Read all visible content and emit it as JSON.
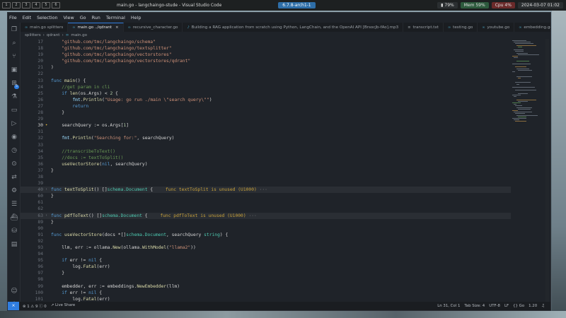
{
  "system_bar": {
    "workspaces": [
      "1",
      "2",
      "3",
      "4",
      "5",
      "6"
    ],
    "window_title": "main.go - langchaingo-stude - Visual Studio Code",
    "kernel": "6.7.8-arch1-1",
    "battery": "79%",
    "memory": "Mem 59%",
    "cpu": "Cpu  4%",
    "datetime": "2024-03-07 01:02"
  },
  "menu": [
    "File",
    "Edit",
    "Selection",
    "View",
    "Go",
    "Run",
    "Terminal",
    "Help"
  ],
  "tabs": [
    {
      "label": "main.go  splitters",
      "active": false,
      "kind": "go"
    },
    {
      "label": "main.go  ../qdrant",
      "active": true,
      "kind": "go"
    },
    {
      "label": "recursive_character.go",
      "active": false,
      "kind": "go"
    },
    {
      "label": "Building a RAG application from scratch using Python, LangChain, and the OpenAI API [BrsocJb-fAo].mp3",
      "active": false,
      "kind": "media"
    },
    {
      "label": "transcript.txt",
      "active": false,
      "kind": "txt"
    },
    {
      "label": "testing.go",
      "active": false,
      "kind": "go"
    },
    {
      "label": "youtube.go",
      "active": false,
      "kind": "go"
    },
    {
      "label": "embedding.go",
      "active": false,
      "kind": "go"
    }
  ],
  "breadcrumb": [
    "splitters",
    "qdrant",
    "main.go"
  ],
  "editor_lines": [
    {
      "n": "17",
      "parts": [
        [
          "str",
          "\"github.com/tmc/langchaingo/schema\""
        ]
      ],
      "indent": 1
    },
    {
      "n": "18",
      "parts": [
        [
          "str",
          "\"github.com/tmc/langchaingo/textsplitter\""
        ]
      ],
      "indent": 1
    },
    {
      "n": "19",
      "parts": [
        [
          "str",
          "\"github.com/tmc/langchaingo/vectorstores\""
        ]
      ],
      "indent": 1
    },
    {
      "n": "20",
      "parts": [
        [
          "str",
          "\"github.com/tmc/langchaingo/vectorstores/qdrant\""
        ]
      ],
      "indent": 1
    },
    {
      "n": "21",
      "parts": [
        [
          "pl",
          ")"
        ]
      ],
      "indent": 0
    },
    {
      "n": "22",
      "parts": [],
      "indent": 0
    },
    {
      "n": "23",
      "parts": [
        [
          "kw",
          "func "
        ],
        [
          "fn",
          "main"
        ],
        [
          "pl",
          "() {"
        ]
      ],
      "indent": 0
    },
    {
      "n": "24",
      "parts": [
        [
          "cm",
          "//get param in cli"
        ]
      ],
      "indent": 1
    },
    {
      "n": "25",
      "parts": [
        [
          "kw",
          "if "
        ],
        [
          "fn",
          "len"
        ],
        [
          "pl",
          "(os.Args) < "
        ],
        [
          "num",
          "2"
        ],
        [
          "pl",
          " {"
        ]
      ],
      "indent": 1
    },
    {
      "n": "26",
      "parts": [
        [
          "pk",
          "fmt"
        ],
        [
          "pl",
          "."
        ],
        [
          "fn",
          "Println"
        ],
        [
          "pl",
          "("
        ],
        [
          "str",
          "\"Usage: go run ./main \\\"search query\\\"\""
        ],
        [
          "pl",
          ")"
        ]
      ],
      "indent": 2
    },
    {
      "n": "27",
      "parts": [
        [
          "kw",
          "return"
        ]
      ],
      "indent": 2
    },
    {
      "n": "28",
      "parts": [
        [
          "pl",
          "}"
        ]
      ],
      "indent": 1
    },
    {
      "n": "29",
      "parts": [],
      "indent": 0
    },
    {
      "n": "30",
      "parts": [
        [
          "pl",
          "searchQuery := os.Args["
        ],
        [
          "num",
          "1"
        ],
        [
          "pl",
          "]"
        ]
      ],
      "indent": 1,
      "bulb": true,
      "current": true
    },
    {
      "n": "31",
      "parts": [],
      "indent": 0
    },
    {
      "n": "32",
      "parts": [
        [
          "pk",
          "fmt"
        ],
        [
          "pl",
          "."
        ],
        [
          "fn",
          "Println"
        ],
        [
          "pl",
          "("
        ],
        [
          "str",
          "\"Searching for:\""
        ],
        [
          "pl",
          ", searchQuery)"
        ]
      ],
      "indent": 1
    },
    {
      "n": "33",
      "parts": [],
      "indent": 0
    },
    {
      "n": "34",
      "parts": [
        [
          "cm",
          "//transcribeToText()"
        ]
      ],
      "indent": 1
    },
    {
      "n": "35",
      "parts": [
        [
          "cm",
          "//docs := textToSplit()"
        ]
      ],
      "indent": 1
    },
    {
      "n": "36",
      "parts": [
        [
          "fn",
          "useVectorStore"
        ],
        [
          "pl",
          "("
        ],
        [
          "kw",
          "nil"
        ],
        [
          "pl",
          ", searchQuery)"
        ]
      ],
      "indent": 1
    },
    {
      "n": "37",
      "parts": [
        [
          "pl",
          "}"
        ]
      ],
      "indent": 0
    },
    {
      "n": "38",
      "parts": [],
      "indent": 0
    },
    {
      "n": "39",
      "parts": [],
      "indent": 0
    },
    {
      "n": "40",
      "parts": [
        [
          "kw",
          "func "
        ],
        [
          "fn",
          "textToSplit"
        ],
        [
          "pl",
          "() []"
        ],
        [
          "ty",
          "schema.Document"
        ],
        [
          "pl",
          " {"
        ]
      ],
      "indent": 0,
      "fold": true,
      "highlight": true,
      "diag": "func textToSplit is unused (U1000)"
    },
    {
      "n": "60",
      "parts": [
        [
          "pl",
          "}"
        ]
      ],
      "indent": 0
    },
    {
      "n": "61",
      "parts": [],
      "indent": 0
    },
    {
      "n": "62",
      "parts": [],
      "indent": 0
    },
    {
      "n": "63",
      "parts": [
        [
          "kw",
          "func "
        ],
        [
          "fn",
          "pdfToText"
        ],
        [
          "pl",
          "() []"
        ],
        [
          "ty",
          "schema.Document"
        ],
        [
          "pl",
          " {"
        ]
      ],
      "indent": 0,
      "fold": true,
      "highlight": true,
      "diag": "func pdfToText is unused (U1000)"
    },
    {
      "n": "89",
      "parts": [
        [
          "pl",
          "}"
        ]
      ],
      "indent": 0
    },
    {
      "n": "90",
      "parts": [],
      "indent": 0
    },
    {
      "n": "91",
      "parts": [
        [
          "kw",
          "func "
        ],
        [
          "fn",
          "useVectorStore"
        ],
        [
          "pl",
          "(docs *[]"
        ],
        [
          "ty",
          "schema.Document"
        ],
        [
          "pl",
          ", searchQuery "
        ],
        [
          "ty",
          "string"
        ],
        [
          "pl",
          ") {"
        ]
      ],
      "indent": 0
    },
    {
      "n": "92",
      "parts": [],
      "indent": 0
    },
    {
      "n": "93",
      "parts": [
        [
          "pl",
          "llm, err := ollama."
        ],
        [
          "fn",
          "New"
        ],
        [
          "pl",
          "(ollama."
        ],
        [
          "fn",
          "WithModel"
        ],
        [
          "pl",
          "("
        ],
        [
          "str",
          "\"llama2\""
        ],
        [
          "pl",
          "))"
        ]
      ],
      "indent": 1
    },
    {
      "n": "94",
      "parts": [],
      "indent": 0
    },
    {
      "n": "95",
      "parts": [
        [
          "kw",
          "if "
        ],
        [
          "pl",
          "err != "
        ],
        [
          "kw",
          "nil"
        ],
        [
          "pl",
          " {"
        ]
      ],
      "indent": 1
    },
    {
      "n": "96",
      "parts": [
        [
          "pl",
          "log."
        ],
        [
          "fn",
          "Fatal"
        ],
        [
          "pl",
          "(err)"
        ]
      ],
      "indent": 2
    },
    {
      "n": "97",
      "parts": [
        [
          "pl",
          "}"
        ]
      ],
      "indent": 1
    },
    {
      "n": "98",
      "parts": [],
      "indent": 0
    },
    {
      "n": "99",
      "parts": [
        [
          "pl",
          "embedder, err := embeddings."
        ],
        [
          "fn",
          "NewEmbedder"
        ],
        [
          "pl",
          "(llm)"
        ]
      ],
      "indent": 1
    },
    {
      "n": "100",
      "parts": [
        [
          "kw",
          "if "
        ],
        [
          "pl",
          "err != "
        ],
        [
          "kw",
          "nil"
        ],
        [
          "pl",
          " {"
        ]
      ],
      "indent": 1
    },
    {
      "n": "101",
      "parts": [
        [
          "pl",
          "log."
        ],
        [
          "fn",
          "Fatal"
        ],
        [
          "pl",
          "(err)"
        ]
      ],
      "indent": 2
    },
    {
      "n": "102",
      "parts": [
        [
          "pl",
          "}"
        ]
      ],
      "indent": 1
    }
  ],
  "status": {
    "remote": "⨯",
    "errors": "1",
    "warnings": "9",
    "info": "0",
    "live_share": "Live Share",
    "position": "Ln 31, Col 1",
    "tab_size": "Tab Size: 4",
    "encoding": "UTF-8",
    "eol": "LF",
    "language": "Go",
    "version": "1.20"
  },
  "colors": {
    "editor_bg": "#1f2329",
    "accent": "#2f7de0",
    "keyword": "#569cd6",
    "string": "#ce9178",
    "function": "#dcdcaa",
    "comment": "#6a9955",
    "type": "#4ec9b0"
  }
}
